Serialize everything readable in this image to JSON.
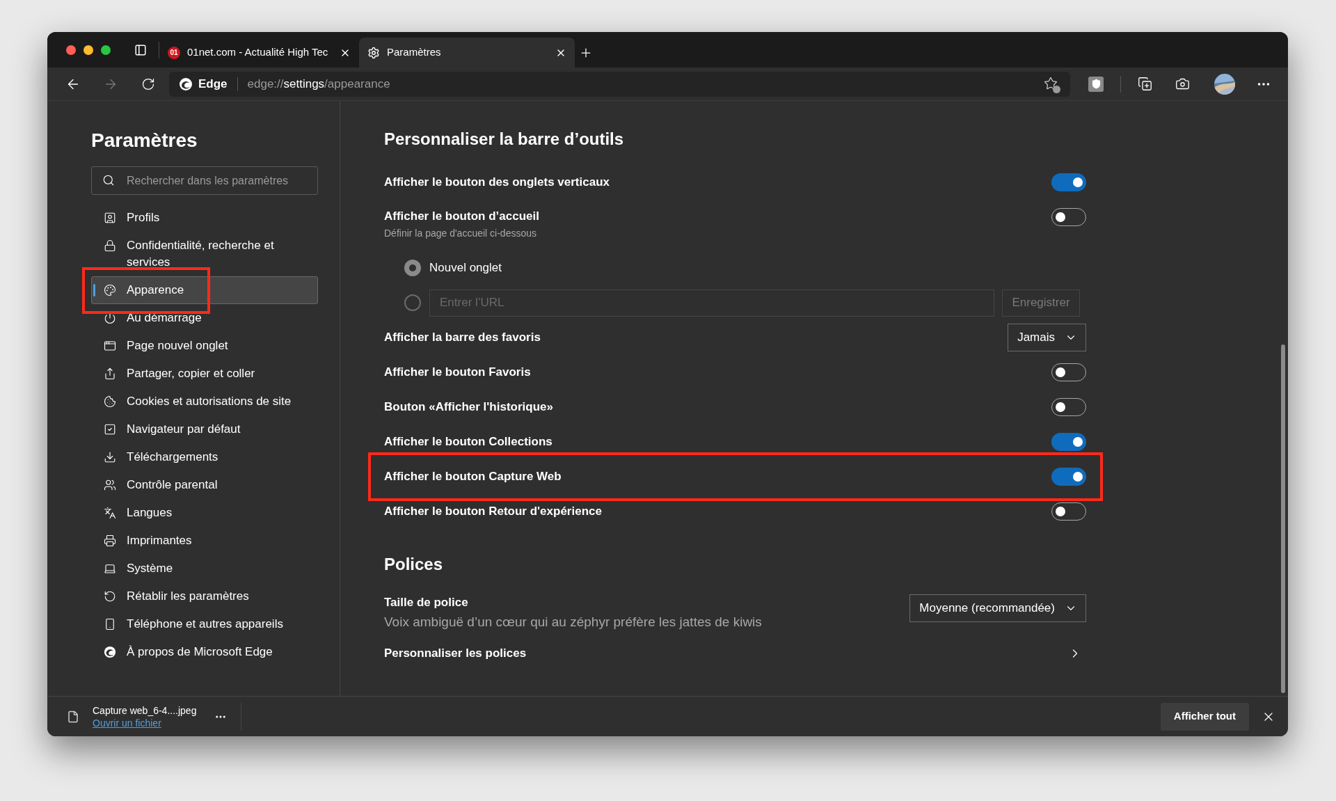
{
  "browser": {
    "tabs": [
      {
        "favicon": "01",
        "title": "01net.com - Actualité High Tec",
        "selected": false
      },
      {
        "title": "Paramètres",
        "selected": true
      }
    ],
    "address_bar": {
      "site": "Edge",
      "url_scheme": "edge://",
      "url_host": "settings",
      "url_path": "/appearance"
    }
  },
  "sidebar": {
    "title": "Paramètres",
    "search": {
      "placeholder": "Rechercher dans les paramètres"
    },
    "items": [
      {
        "label": "Profils",
        "selected": false,
        "highlighted": false
      },
      {
        "label": "Confidentialité, recherche et services",
        "selected": false,
        "highlighted": false
      },
      {
        "label": "Apparence",
        "selected": true,
        "highlighted": true
      },
      {
        "label": "Au démarrage",
        "selected": false,
        "highlighted": false
      },
      {
        "label": "Page nouvel onglet",
        "selected": false,
        "highlighted": false
      },
      {
        "label": "Partager, copier et coller",
        "selected": false,
        "highlighted": false
      },
      {
        "label": "Cookies et autorisations de site",
        "selected": false,
        "highlighted": false
      },
      {
        "label": "Navigateur par défaut",
        "selected": false,
        "highlighted": false
      },
      {
        "label": "Téléchargements",
        "selected": false,
        "highlighted": false
      },
      {
        "label": "Contrôle parental",
        "selected": false,
        "highlighted": false
      },
      {
        "label": "Langues",
        "selected": false,
        "highlighted": false
      },
      {
        "label": "Imprimantes",
        "selected": false,
        "highlighted": false
      },
      {
        "label": "Système",
        "selected": false,
        "highlighted": false
      },
      {
        "label": "Rétablir les paramètres",
        "selected": false,
        "highlighted": false
      },
      {
        "label": "Téléphone et autres appareils",
        "selected": false,
        "highlighted": false
      },
      {
        "label": "À propos de Microsoft Edge",
        "selected": false,
        "highlighted": false
      }
    ]
  },
  "sections": [
    {
      "title": "Personnaliser la barre d’outils",
      "settings": [
        {
          "kind": "toggle",
          "label": "Afficher le bouton des onglets verticaux",
          "on": true,
          "highlighted": false
        },
        {
          "kind": "toggle",
          "label": "Afficher le bouton d’accueil",
          "description": "Définir la page d'accueil ci-dessous",
          "on": false,
          "highlighted": false
        },
        {
          "kind": "radio",
          "label": "Nouvel onglet",
          "selected": true
        },
        {
          "kind": "radio_url",
          "placeholder": "Entrer l’URL",
          "button": "Enregistrer",
          "selected": false
        },
        {
          "kind": "dropdown",
          "label": "Afficher la barre des favoris",
          "value": "Jamais"
        },
        {
          "kind": "toggle",
          "label": "Afficher le bouton Favoris",
          "on": false,
          "highlighted": false
        },
        {
          "kind": "toggle",
          "label": "Bouton «Afficher l'historique»",
          "on": false,
          "highlighted": false
        },
        {
          "kind": "toggle",
          "label": "Afficher le bouton Collections",
          "on": true,
          "highlighted": false
        },
        {
          "kind": "toggle",
          "label": "Afficher le bouton Capture Web",
          "on": true,
          "highlighted": true
        },
        {
          "kind": "toggle",
          "label": "Afficher le bouton Retour d'expérience",
          "on": false,
          "highlighted": false
        }
      ]
    },
    {
      "title": "Polices",
      "settings": [
        {
          "kind": "dropdown",
          "label": "Taille de police",
          "description": "Voix ambiguë d’un cœur qui au zéphyr préfère les jattes de kiwis",
          "value": "Moyenne (recommandée)"
        },
        {
          "kind": "link",
          "label": "Personnaliser les polices"
        }
      ]
    }
  ],
  "download_bar": {
    "filename": "Capture web_6-4....jpeg",
    "link": "Ouvrir un fichier",
    "button": "Afficher tout"
  }
}
